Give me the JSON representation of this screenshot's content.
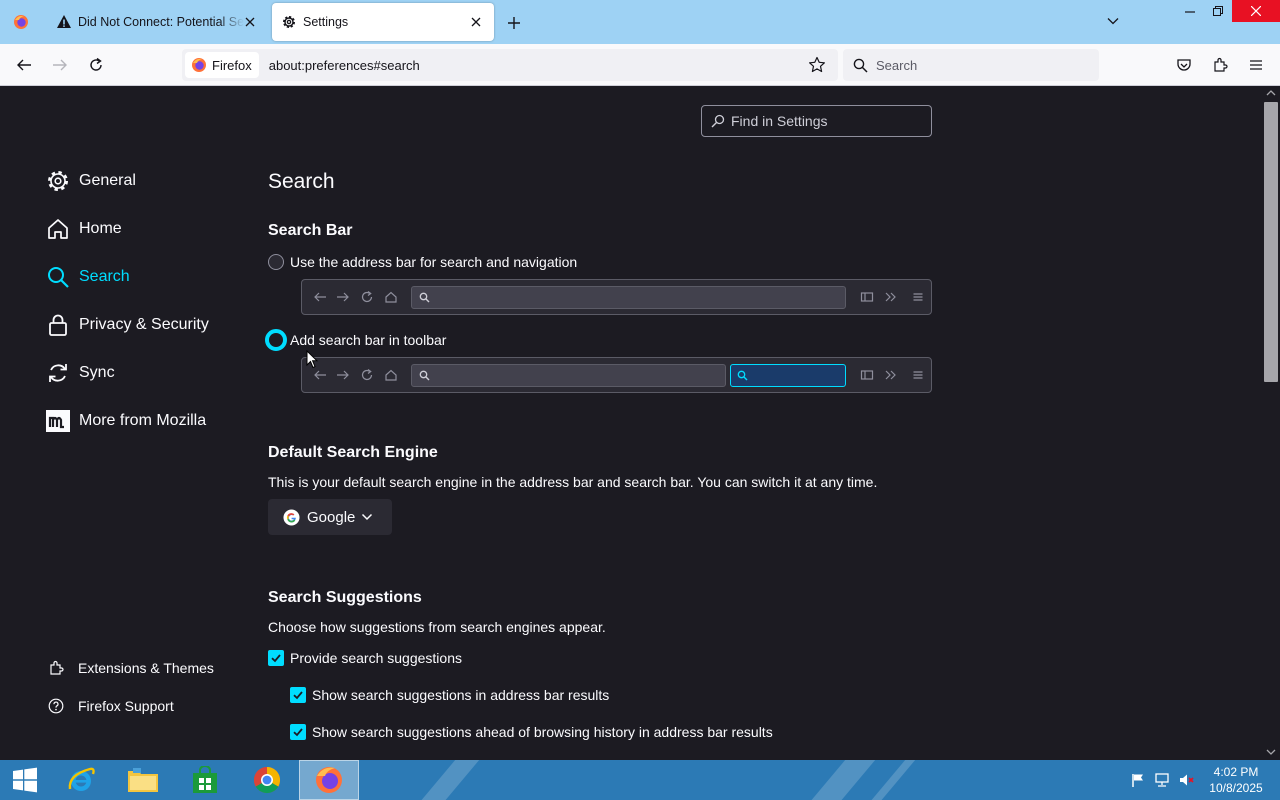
{
  "browser": {
    "tabs": [
      {
        "label": "Did Not Connect: Potential Security Issue",
        "icon": "warning-icon"
      },
      {
        "label": "Settings",
        "icon": "gear-icon",
        "active": true
      }
    ],
    "identity_label": "Firefox",
    "url": "about:preferences#search",
    "search_placeholder": "Search"
  },
  "settings": {
    "find_placeholder": "Find in Settings",
    "categories": [
      {
        "label": "General",
        "icon": "gear-icon"
      },
      {
        "label": "Home",
        "icon": "home-icon"
      },
      {
        "label": "Search",
        "icon": "search-icon",
        "selected": true
      },
      {
        "label": "Privacy & Security",
        "icon": "lock-icon"
      },
      {
        "label": "Sync",
        "icon": "sync-icon"
      },
      {
        "label": "More from Mozilla",
        "icon": "mozilla-icon"
      }
    ],
    "footer_links": [
      {
        "label": "Extensions & Themes",
        "icon": "puzzle-icon"
      },
      {
        "label": "Firefox Support",
        "icon": "help-icon"
      }
    ],
    "page_title": "Search",
    "search_bar": {
      "heading": "Search Bar",
      "option_address": "Use the address bar for search and navigation",
      "option_toolbar": "Add search bar in toolbar",
      "selected": "toolbar"
    },
    "default_engine": {
      "heading": "Default Search Engine",
      "description": "This is your default search engine in the address bar and search bar. You can switch it at any time.",
      "selected": "Google"
    },
    "suggestions": {
      "heading": "Search Suggestions",
      "description": "Choose how suggestions from search engines appear.",
      "provide": {
        "label": "Provide search suggestions",
        "checked": true
      },
      "in_address_bar": {
        "label": "Show search suggestions in address bar results",
        "checked": true
      },
      "ahead_of_history": {
        "label": "Show search suggestions ahead of browsing history in address bar results",
        "checked": true
      }
    }
  },
  "taskbar": {
    "time": "4:02 PM",
    "date": "10/8/2025"
  },
  "colors": {
    "accent": "#00ddff",
    "page_bg": "#1c1b22",
    "tabstrip_bg": "#9ed2f4",
    "taskbar_bg": "#2c7ab5"
  }
}
